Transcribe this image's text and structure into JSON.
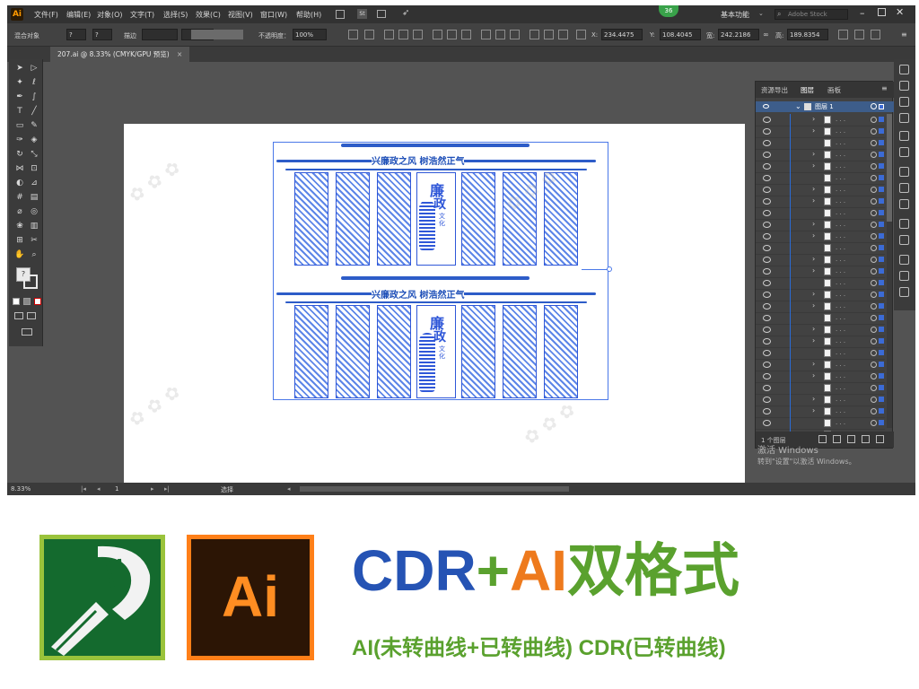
{
  "menubar": {
    "logo": "Ai",
    "items": [
      "文件(F)",
      "编辑(E)",
      "对象(O)",
      "文字(T)",
      "选择(S)",
      "效果(C)",
      "视图(V)",
      "窗口(W)",
      "帮助(H)"
    ],
    "st_label": "St",
    "badge": "36",
    "workspace": "基本功能",
    "search_placeholder": "Adobe Stock"
  },
  "controlbar": {
    "mode_label": "混合对象",
    "stroke_label": "描边",
    "opacity_label": "不透明度：",
    "opacity_value": "100%",
    "x_label": "X:",
    "x_value": "234.4475",
    "y_label": "Y:",
    "y_value": "108.4045",
    "w_label": "宽:",
    "w_value": "242.2186",
    "h_label": "高:",
    "h_value": "189.8354"
  },
  "document": {
    "tab_title": "207.ai @ 8.33% (CMYK/GPU 预览)",
    "tab_close": "×"
  },
  "design": {
    "title_top": "兴廉政之风  树浩然正气",
    "title_bottom": "兴廉政之风  树浩然正气",
    "center_char1": "廉",
    "center_char2": "政",
    "center_small": "文化"
  },
  "statusbar": {
    "zoom": "8.33%",
    "page": "1",
    "tool_label": "选择"
  },
  "layers_panel": {
    "tabs": [
      "资源导出",
      "图层",
      "画板"
    ],
    "top_layer": "图层 1",
    "footer_label": "1 个图层"
  },
  "activation": {
    "line1": "激活 Windows",
    "line2": "转到\"设置\"以激活 Windows。"
  },
  "promo": {
    "ai_logo_text": "Ai",
    "headline_cdr": "CDR",
    "headline_plus": "+",
    "headline_ai": "AI",
    "headline_format": "双格式",
    "subline": "AI(未转曲线+已转曲线) CDR(已转曲线)"
  },
  "colors": {
    "cdr_blue": "#2553b4",
    "plus_green": "#5aa12e",
    "ai_orange": "#ee7a1d",
    "format_green": "#5aa12e",
    "design_blue": "#2f57d8"
  },
  "icons": {
    "toolbox": [
      "selection-icon",
      "direct-selection-icon",
      "magic-wand-icon",
      "lasso-icon",
      "pen-icon",
      "curvature-icon",
      "type-icon",
      "line-icon",
      "rectangle-icon",
      "paintbrush-icon",
      "shaper-icon",
      "eraser-icon",
      "rotate-icon",
      "scale-icon",
      "width-icon",
      "free-transform-icon",
      "shape-builder-icon",
      "perspective-icon",
      "mesh-icon",
      "gradient-icon",
      "eyedropper-icon",
      "blend-icon",
      "symbol-sprayer-icon",
      "column-graph-icon",
      "artboard-icon",
      "slice-icon",
      "hand-icon",
      "zoom-icon"
    ]
  }
}
